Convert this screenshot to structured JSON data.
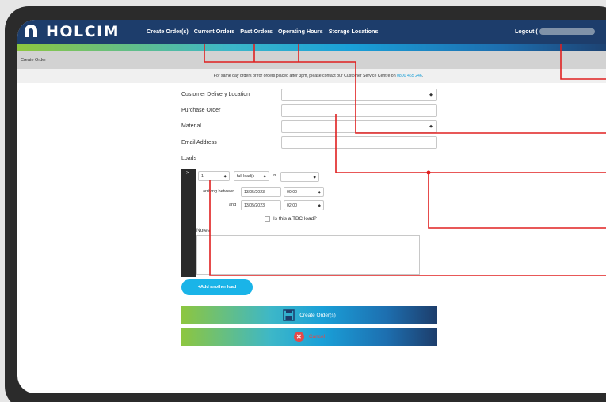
{
  "brand": {
    "name": "HOLCIM"
  },
  "nav": [
    {
      "label": "Create Order(s)"
    },
    {
      "label": "Current Orders"
    },
    {
      "label": "Past Orders"
    },
    {
      "label": "Operating Hours"
    },
    {
      "label": "Storage Locations"
    }
  ],
  "logout_label": "Logout (",
  "breadcrumb": "Create Order",
  "notice": {
    "text": "For same day orders or for orders placed after 3pm, please contact our Customer Service Centre on ",
    "phone": "0800 465 246",
    "end": "."
  },
  "form": {
    "customer_delivery_location": "Customer Delivery Location",
    "purchase_order": "Purchase Order",
    "material": "Material",
    "email_address": "Email Address",
    "loads": "Loads"
  },
  "load": {
    "toggle": ">",
    "quantity": "1",
    "unit": "full load(s",
    "in_label": "in",
    "arriving_between": "arriving between",
    "from_date": "13/05/2023",
    "from_time": "00:00",
    "and_label": "and",
    "to_date": "13/05/2023",
    "to_time": "02:00",
    "tbc_label": "Is this a TBC load?",
    "notes_label": "Notes"
  },
  "buttons": {
    "add_load": "+Add another load",
    "create": "Create Order(s)",
    "cancel": "Cancel"
  },
  "colors": {
    "navy": "#1d3d6b",
    "accent": "#1aa0d8",
    "green": "#8dc63f",
    "annotation": "#e02020"
  }
}
